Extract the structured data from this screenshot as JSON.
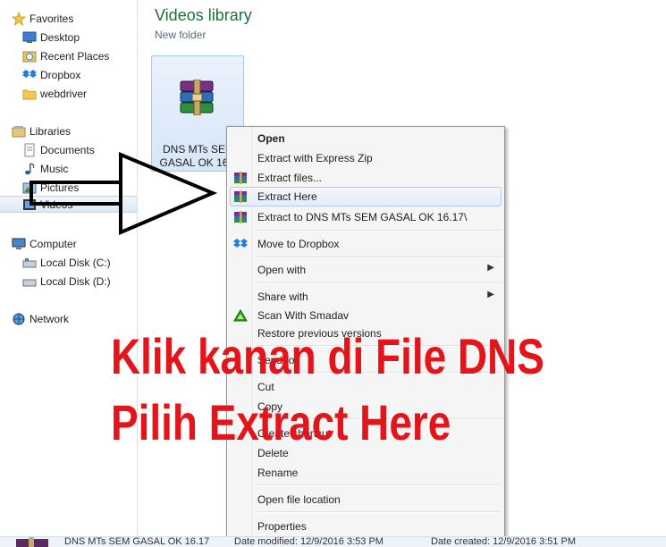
{
  "nav": {
    "favorites": "Favorites",
    "desktop": "Desktop",
    "recent_places": "Recent Places",
    "dropbox": "Dropbox",
    "webdriver": "webdriver",
    "libraries": "Libraries",
    "documents": "Documents",
    "music": "Music",
    "pictures": "Pictures",
    "videos": "Videos",
    "computer": "Computer",
    "local_c": "Local Disk (C:)",
    "local_d": "Local Disk (D:)",
    "network": "Network"
  },
  "content": {
    "title": "Videos library",
    "subtitle": "New folder",
    "file_name_line1": "DNS MTs SEM",
    "file_name_line2": "GASAL OK 16.1"
  },
  "menu": {
    "open": "Open",
    "extract_express": "Extract with Express Zip",
    "extract_files": "Extract files...",
    "extract_here": "Extract Here",
    "extract_to": "Extract to DNS MTs SEM GASAL OK 16.17\\",
    "move_dropbox": "Move to Dropbox",
    "open_with": "Open with",
    "share_with": "Share with",
    "scan_smadav": "Scan With Smadav",
    "restore": "Restore previous versions",
    "send_to": "Send to",
    "cut": "Cut",
    "copy": "Copy",
    "create_shortcut": "Create shortcut",
    "delete": "Delete",
    "rename": "Rename",
    "open_location": "Open file location",
    "properties": "Properties"
  },
  "overlay": {
    "line1": "Klik kanan di File DNS",
    "line2": "Pilih Extract Here"
  },
  "status": {
    "name": "DNS MTs SEM GASAL OK 16.17",
    "modified": "Date modified: 12/9/2016 3:53 PM",
    "created": "Date created: 12/9/2016 3:51 PM"
  },
  "colors": {
    "accent_title": "#1e6e3a",
    "annotation_red": "#e4141b",
    "menu_highlight": "#aecbf0"
  },
  "icons": {
    "favorites": "star-icon",
    "archive": "winrar-archive-icon",
    "dropbox": "dropbox-icon",
    "smadav": "smadav-icon",
    "submenu": "chevron-right-icon"
  }
}
